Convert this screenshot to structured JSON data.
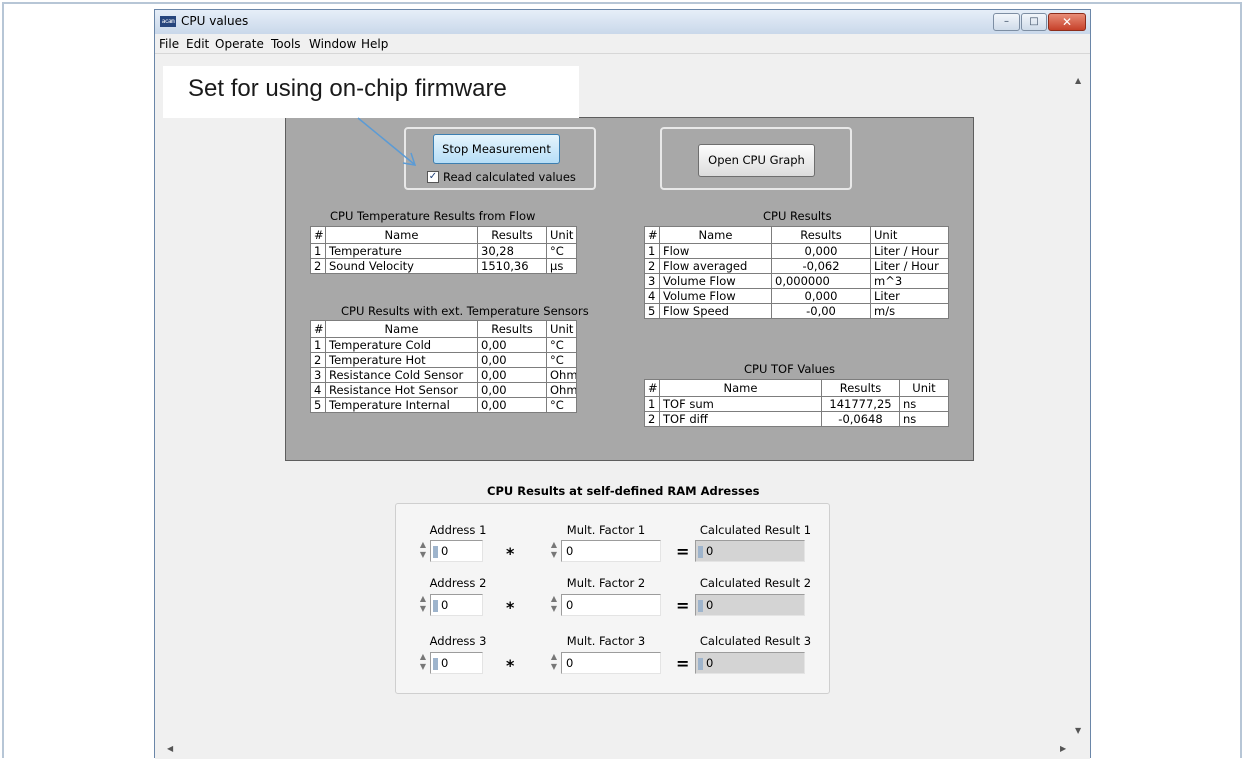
{
  "window": {
    "title": "CPU values",
    "icon_text": "acam",
    "controls": {
      "minimize": "–",
      "maximize": "□",
      "close": "✕"
    }
  },
  "menu": [
    "File",
    "Edit",
    "Operate",
    "Tools",
    "Window",
    "Help"
  ],
  "annotation": {
    "text": "Set for using on-chip firmware"
  },
  "measurement": {
    "stop_button": "Stop Measurement",
    "read_calculated_label": "Read calculated values",
    "read_calculated_checked": true,
    "open_graph_button": "Open CPU Graph"
  },
  "temp_flow": {
    "title": "CPU Temperature Results from Flow",
    "headers": [
      "#",
      "Name",
      "Results",
      "Unit"
    ],
    "rows": [
      [
        "1",
        "Temperature",
        "30,28",
        "°C"
      ],
      [
        "2",
        "Sound Velocity",
        "1510,36",
        "µs"
      ]
    ]
  },
  "ext_temp": {
    "title": "CPU Results with ext. Temperature Sensors",
    "headers": [
      "#",
      "Name",
      "Results",
      "Unit"
    ],
    "rows": [
      [
        "1",
        "Temperature Cold",
        "0,00",
        "°C"
      ],
      [
        "2",
        "Temperature Hot",
        "0,00",
        "°C"
      ],
      [
        "3",
        "Resistance Cold Sensor",
        "0,00",
        "Ohm"
      ],
      [
        "4",
        "Resistance Hot Sensor",
        "0,00",
        "Ohm"
      ],
      [
        "5",
        "Temperature Internal",
        "0,00",
        "°C"
      ]
    ]
  },
  "cpu_results": {
    "title": "CPU Results",
    "headers": [
      "#",
      "Name",
      "Results",
      "Unit"
    ],
    "rows": [
      [
        "1",
        "Flow",
        "0,000",
        "Liter / Hour"
      ],
      [
        "2",
        "Flow averaged",
        "-0,062",
        "Liter / Hour"
      ],
      [
        "3",
        "Volume Flow",
        "0,000000",
        "m^3"
      ],
      [
        "4",
        "Volume Flow",
        "0,000",
        "Liter"
      ],
      [
        "5",
        "Flow Speed",
        "-0,00",
        "m/s"
      ]
    ]
  },
  "tof": {
    "title": "CPU TOF Values",
    "headers": [
      "#",
      "Name",
      "Results",
      "Unit"
    ],
    "rows": [
      [
        "1",
        "TOF sum",
        "141777,25",
        "ns"
      ],
      [
        "2",
        "TOF diff",
        "-0,0648",
        "ns"
      ]
    ]
  },
  "ram": {
    "title": "CPU Results at self-defined RAM Adresses",
    "rows": [
      {
        "address_label": "Address 1",
        "address": "0",
        "factor_label": "Mult. Factor 1",
        "factor": "0",
        "result_label": "Calculated Result 1",
        "result": "0"
      },
      {
        "address_label": "Address 2",
        "address": "0",
        "factor_label": "Mult. Factor 2",
        "factor": "0",
        "result_label": "Calculated Result 2",
        "result": "0"
      },
      {
        "address_label": "Address 3",
        "address": "0",
        "factor_label": "Mult. Factor 3",
        "factor": "0",
        "result_label": "Calculated Result 3",
        "result": "0"
      }
    ],
    "multiply_symbol": "*",
    "equals_symbol": "="
  },
  "colors": {
    "panel": "#a8a8a8",
    "button_active": "#b6def7",
    "annotation_arrow": "#5b9bd5"
  }
}
